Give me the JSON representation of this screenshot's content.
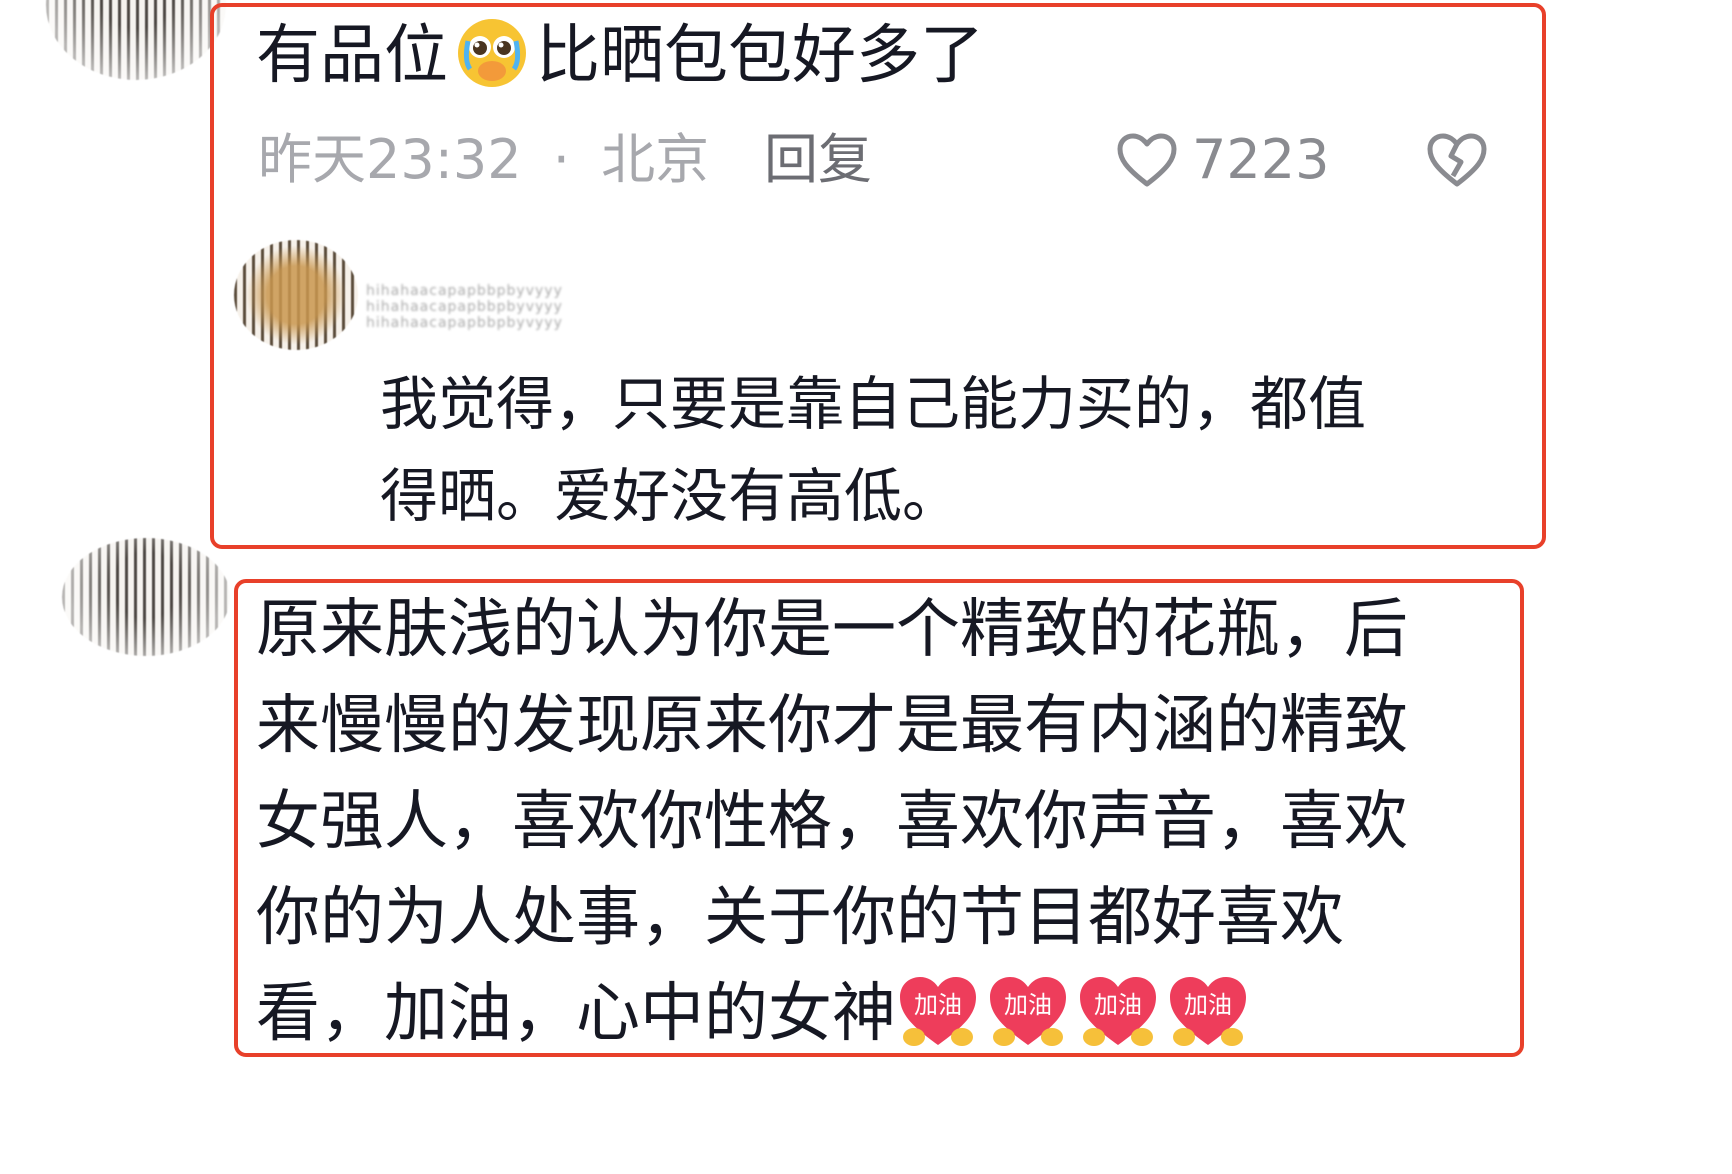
{
  "comment1": {
    "text_before_emoji": "有品位",
    "emoji": "crying-face-emoji",
    "text_after_emoji": "比晒包包好多了",
    "timestamp": "昨天23:32",
    "separator": "·",
    "location": "北京",
    "reply_label": "回复",
    "like_count": "7223"
  },
  "reply1": {
    "username": "hihahaacapapbbpbyvyyy",
    "text_line1": "我觉得，只要是靠自己能力买的，都值",
    "text_line2": "得晒。爱好没有高低。"
  },
  "comment2": {
    "line1": "原来肤浅的认为你是一个精致的花瓶，后",
    "line2": "来慢慢的发现原来你才是最有内涵的精致",
    "line3": "女强人，喜欢你性格，喜欢你声音，喜欢",
    "line4": "你的为人处事，关于你的节目都好喜欢",
    "line5_text": "看，加油，心中的女神",
    "emoji_label": "加油",
    "emoji_count": 4
  },
  "colors": {
    "highlight_border": "#e8402a",
    "text": "#161823",
    "meta": "#a7a8ad"
  }
}
